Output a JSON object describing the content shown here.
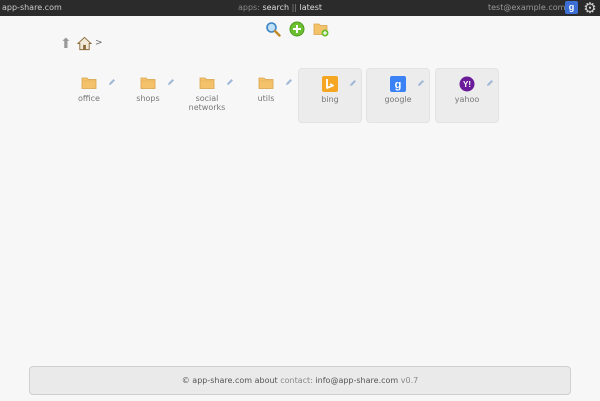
{
  "topbar": {
    "brand": "app-share.com",
    "apps_label": "apps:",
    "search_link": "search",
    "separator": "||",
    "latest_link": "latest",
    "user_email": "test@example.com",
    "account_badge": "g"
  },
  "tiles": [
    {
      "label": "office",
      "icon": "folder-icon"
    },
    {
      "label": "shops",
      "icon": "folder-icon"
    },
    {
      "label": "social networks",
      "icon": "folder-icon"
    },
    {
      "label": "utils",
      "icon": "folder-icon"
    },
    {
      "label": "bing",
      "icon": "bing-icon",
      "color": "#f5a623"
    },
    {
      "label": "google",
      "icon": "google-icon",
      "badge": "g",
      "color": "#3b82f6"
    },
    {
      "label": "yahoo",
      "icon": "yahoo-icon",
      "badge": "Y!",
      "color": "#6a1b9a"
    }
  ],
  "breadcrumb": {
    "separator": ">"
  },
  "footer": {
    "copyright": "© app-share.com",
    "about": "about",
    "contact_label": "contact:",
    "email": "info@app-share.com",
    "version": "v0.7"
  },
  "colors": {
    "topbar_bg": "#2b2b2b",
    "folder": "#f4c26b",
    "add_green": "#6cbf2f",
    "page_bg": "#f7f7f7"
  }
}
